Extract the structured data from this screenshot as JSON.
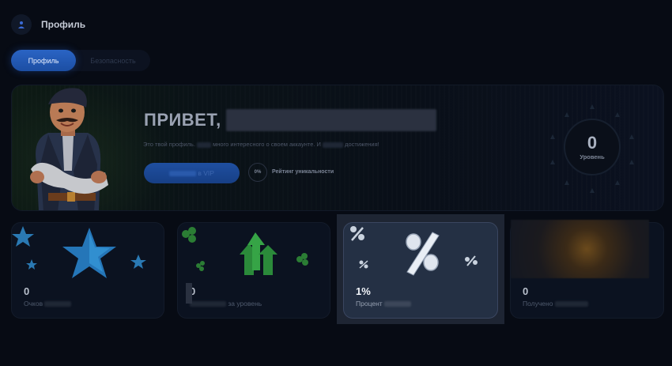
{
  "header": {
    "title": "Профиль",
    "avatar_icon": "user-icon"
  },
  "tabs": [
    {
      "label": "Профиль",
      "active": true
    },
    {
      "label": "Безопасность",
      "active": false
    }
  ],
  "hero": {
    "greeting": "ПРИВЕТ,",
    "description_start": "Это твой профиль.",
    "description_mid": "много интересного о своем аккаунте. И",
    "description_end": "достижения!",
    "vip_button_label": "в VIP",
    "uniqueness_percent": "0%",
    "uniqueness_label": "Рейтинг уникальности",
    "level_value": "0",
    "level_label": "Уровень"
  },
  "cards": [
    {
      "value": "0",
      "label": "Очков",
      "icon": "star-icon",
      "accent": "#2f8fd6"
    },
    {
      "value": "0",
      "label": "за уровень",
      "icon": "arrows-up-icon",
      "accent": "#3fae4a"
    },
    {
      "value": "1%",
      "label": "Процент",
      "icon": "percent-icon",
      "accent": "#d8e0ec"
    },
    {
      "value": "0",
      "label": "Получено",
      "icon": "sun-image",
      "accent": "#e8a23c"
    }
  ],
  "colors": {
    "background": "#070b14",
    "primary": "#1f4fa0"
  }
}
